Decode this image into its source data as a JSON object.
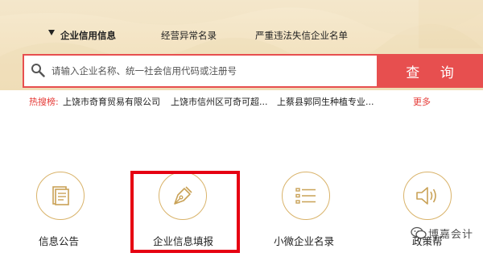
{
  "tabs": [
    {
      "label": "企业信用信息",
      "active": true
    },
    {
      "label": "经营异常名录",
      "active": false
    },
    {
      "label": "严重违法失信企业名单",
      "active": false
    }
  ],
  "search": {
    "placeholder": "请输入企业名称、统一社会信用代码或注册号",
    "value": "",
    "button_label": "查 询"
  },
  "hot_search": {
    "label": "热搜榜:",
    "items": [
      "上饶市奇育贸易有限公司",
      "上饶市信州区可奇可超...",
      "上蔡县郭同生种植专业..."
    ],
    "more": "更多"
  },
  "features": [
    {
      "label": "信息公告",
      "icon": "document-icon"
    },
    {
      "label": "企业信息填报",
      "icon": "pen-nib-icon",
      "highlighted": true
    },
    {
      "label": "小微企业名录",
      "icon": "list-icon"
    },
    {
      "label": "政策帮",
      "icon": "speaker-icon"
    }
  ],
  "watermark": {
    "text": "博嘉会计",
    "icon": "wechat-icon"
  },
  "colors": {
    "accent": "#e74f4f",
    "gold": "#d9b36a",
    "highlight": "#e60012",
    "hot": "#e53935"
  }
}
